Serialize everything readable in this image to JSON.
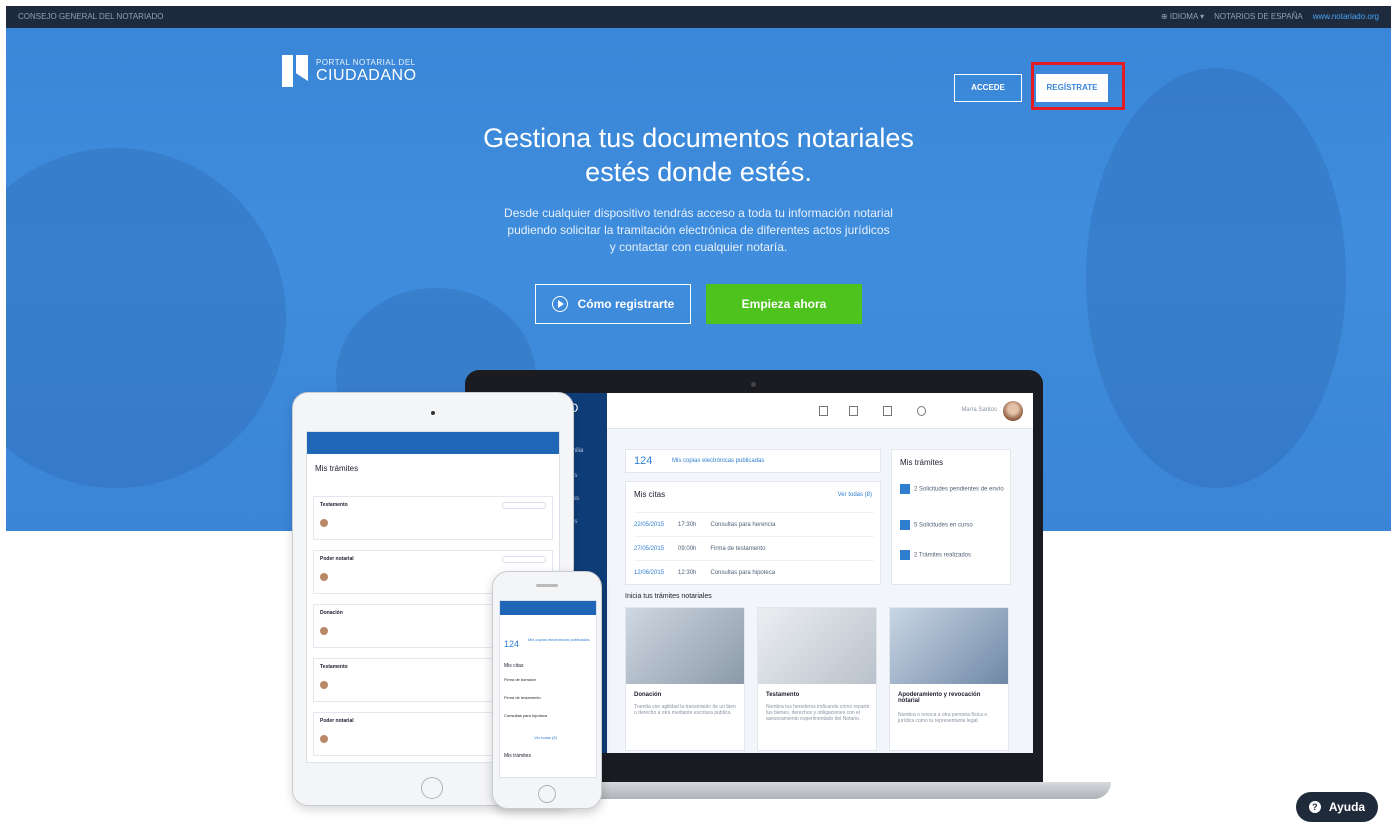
{
  "topbar": {
    "org": "CONSEJO GENERAL DEL NOTARIADO",
    "language": "IDIOMA",
    "notaries": "NOTARIOS DE ESPAÑA",
    "site": "www.notariado.org"
  },
  "logo": {
    "small": "PORTAL NOTARIAL DEL",
    "big": "CIUDADANO"
  },
  "header": {
    "accede_label": "ACCEDE",
    "registrate_label": "REGÍSTRATE"
  },
  "hero": {
    "headline_1": "Gestiona tus documentos notariales",
    "headline_2": "estés donde estés.",
    "sub_1": "Desde cualquier dispositivo tendrás acceso a toda tu información notarial",
    "sub_2": "pudiendo solicitar la tramitación electrónica de diferentes actos jurídicos",
    "sub_3": "y contactar con cualquier notaría.",
    "como_label": "Cómo registrarte",
    "empieza_label": "Empieza ahora"
  },
  "laptop_screen": {
    "user": "María Santos",
    "copies_count": "124",
    "copies_label": "Mis copias electrónicas publicadas",
    "citas_title": "Mis citas",
    "ver_todas": "Ver todas (8)",
    "citas": [
      {
        "date": "22/05/2015",
        "time": "17:30h",
        "desc": "Consultas para herencia"
      },
      {
        "date": "27/05/2015",
        "time": "09:00h",
        "desc": "Firma de testamento"
      },
      {
        "date": "12/06/2015",
        "time": "12:30h",
        "desc": "Consultas para hipoteca"
      }
    ],
    "tramites_title": "Mis trámites",
    "tramites": [
      "2 Solicitudes pendientes de envío",
      "5 Solicitudes en curso",
      "2 Trámites realizados"
    ],
    "inicia": "Inicia tus trámites notariales",
    "tiles": [
      {
        "title": "Donación",
        "desc": "Tramita con agilidad la transmisión de un bien o derecho a otra mediante escritura pública."
      },
      {
        "title": "Testamento",
        "desc": "Nombra tus herederos indicando cómo repartir tus bienes, derechos y obligaciones con el asesoramiento experimentado del Notario."
      },
      {
        "title": "Apoderamiento y revocación notarial",
        "desc": "Nombra o revoca a otra persona física o jurídica como tu representante legal."
      }
    ]
  },
  "tablet_screen": {
    "title": "Mis trámites",
    "rows": [
      "Testamento",
      "Poder notarial",
      "Donación",
      "Testamento",
      "Poder notarial"
    ]
  },
  "phone_screen": {
    "count": "124",
    "copies": "Mis copias electrónicas publicadas",
    "citas": "Mis citas",
    "items": [
      "Firma de borrador",
      "Firma de testamento",
      "Consultas para hipoteca"
    ],
    "ver_todas": "Ver todas (8)",
    "tramites": "Mis trámites"
  },
  "help": {
    "label": "Ayuda"
  },
  "colors": {
    "brand_blue": "#3b86d8",
    "cta_green": "#4ec21d",
    "highlight_red": "#e41b23"
  }
}
